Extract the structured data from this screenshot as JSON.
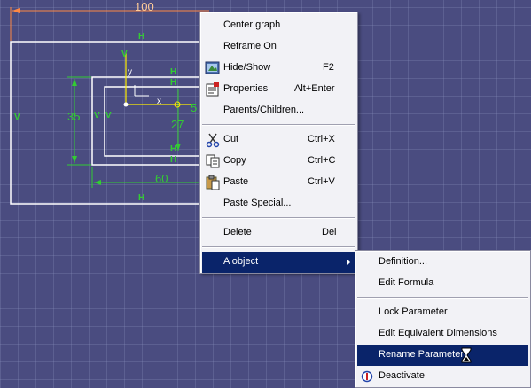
{
  "sketch": {
    "dim_top": "100",
    "dim_left": "35",
    "dim_bottom": "60",
    "dim_right": "27",
    "dim_partial": "5",
    "axis_y": "y",
    "axis_x": "x",
    "constraint_h": "H",
    "constraint_v": "V"
  },
  "context_menu": {
    "items": [
      {
        "label": "Center graph",
        "shortcut": ""
      },
      {
        "label": "Reframe On",
        "shortcut": ""
      },
      {
        "label": "Hide/Show",
        "shortcut": "F2",
        "icon": "hide-show-icon"
      },
      {
        "label": "Properties",
        "shortcut": "Alt+Enter",
        "icon": "properties-icon"
      },
      {
        "label": "Parents/Children...",
        "shortcut": ""
      },
      {
        "label": "Cut",
        "shortcut": "Ctrl+X",
        "icon": "scissors-icon"
      },
      {
        "label": "Copy",
        "shortcut": "Ctrl+C",
        "icon": "copy-icon"
      },
      {
        "label": "Paste",
        "shortcut": "Ctrl+V",
        "icon": "paste-icon"
      },
      {
        "label": "Paste Special...",
        "shortcut": ""
      },
      {
        "label": "Delete",
        "shortcut": "Del"
      },
      {
        "label": "A object",
        "shortcut": ""
      }
    ]
  },
  "submenu": {
    "items": [
      {
        "label": "Definition..."
      },
      {
        "label": "Edit Formula"
      },
      {
        "label": "Lock Parameter"
      },
      {
        "label": "Edit Equivalent Dimensions"
      },
      {
        "label": "Rename Parameter"
      },
      {
        "label": "Deactivate",
        "icon": "deactivate-icon"
      }
    ]
  },
  "colors": {
    "background": "#4a4c80",
    "sketch_line": "#ffffff",
    "dimension": "#33cc33",
    "dimension_top": "#ff8844",
    "highlight": "#0a246a",
    "axis": "#ffee00"
  }
}
